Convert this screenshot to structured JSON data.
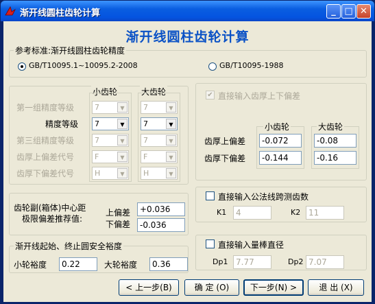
{
  "window": {
    "title": "渐开线圆柱齿轮计算",
    "min": "_",
    "max": "□",
    "close": "✕"
  },
  "heading": "渐开线圆柱齿轮计算",
  "standard": {
    "legend": "参考标准:渐开线圆柱齿轮精度",
    "option1": "GB/T10095.1~10095.2-2008",
    "option2": "GB/T10095-1988",
    "selected": 1
  },
  "precision": {
    "small_header": "小齿轮",
    "large_header": "大齿轮",
    "rows": [
      {
        "label": "第一组精度等级",
        "small": "7",
        "large": "7",
        "enabled": false
      },
      {
        "label": "精度等级",
        "small": "7",
        "large": "7",
        "enabled": true
      },
      {
        "label": "第三组精度等级",
        "small": "7",
        "large": "7",
        "enabled": false
      },
      {
        "label": "齿厚上偏差代号",
        "small": "F",
        "large": "F",
        "enabled": false
      },
      {
        "label": "齿厚下偏差代号",
        "small": "H",
        "large": "H",
        "enabled": false
      }
    ]
  },
  "thickness": {
    "check_label": "直接输入齿厚上下偏差",
    "checked": true,
    "small_header": "小齿轮",
    "large_header": "大齿轮",
    "upper_label": "齿厚上偏差",
    "lower_label": "齿厚下偏差",
    "upper_small": "-0.072",
    "upper_large": "-0.08",
    "lower_small": "-0.144",
    "lower_large": "-0.16"
  },
  "center": {
    "label1": "齿轮副(箱体)中心距",
    "label2": "极限偏差推荐值:",
    "upper_label": "上偏差",
    "lower_label": "下偏差",
    "upper": "+0.036",
    "lower": "-0.036"
  },
  "margin": {
    "legend": "渐开线起始、终止圆安全裕度",
    "small_label": "小轮裕度",
    "small": "0.22",
    "large_label": "大轮裕度",
    "large": "0.36"
  },
  "span": {
    "check_label": "直接输入公法线跨测齿数",
    "k1_label": "K1",
    "k1": "4",
    "k2_label": "K2",
    "k2": "11"
  },
  "rod": {
    "check_label": "直接输入量棒直径",
    "dp1_label": "Dp1",
    "dp1": "7.77",
    "dp2_label": "Dp2",
    "dp2": "7.07"
  },
  "buttons": {
    "prev": "< 上一步(B)",
    "ok": "确 定 (O)",
    "next": "下一步(N) >",
    "exit": "退 出 (X)"
  }
}
